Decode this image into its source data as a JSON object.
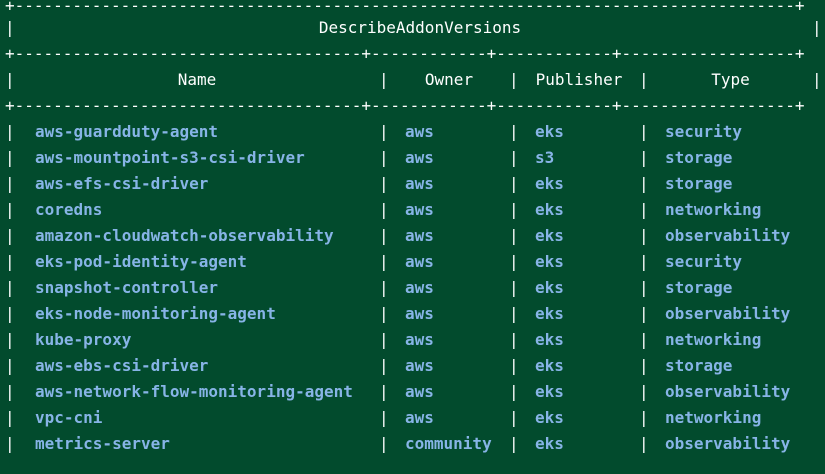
{
  "table": {
    "title": "DescribeAddonVersions",
    "headers": [
      "Name",
      "Owner",
      "Publisher",
      "Type"
    ],
    "rows": [
      [
        "aws-guardduty-agent",
        "aws",
        "eks",
        "security"
      ],
      [
        "aws-mountpoint-s3-csi-driver",
        "aws",
        "s3",
        "storage"
      ],
      [
        "aws-efs-csi-driver",
        "aws",
        "eks",
        "storage"
      ],
      [
        "coredns",
        "aws",
        "eks",
        "networking"
      ],
      [
        "amazon-cloudwatch-observability",
        "aws",
        "eks",
        "observability"
      ],
      [
        "eks-pod-identity-agent",
        "aws",
        "eks",
        "security"
      ],
      [
        "snapshot-controller",
        "aws",
        "eks",
        "storage"
      ],
      [
        "eks-node-monitoring-agent",
        "aws",
        "eks",
        "observability"
      ],
      [
        "kube-proxy",
        "aws",
        "eks",
        "networking"
      ],
      [
        "aws-ebs-csi-driver",
        "aws",
        "eks",
        "storage"
      ],
      [
        "aws-network-flow-monitoring-agent",
        "aws",
        "eks",
        "observability"
      ],
      [
        "vpc-cni",
        "aws",
        "eks",
        "networking"
      ],
      [
        "metrics-server",
        "community",
        "eks",
        "observability"
      ]
    ]
  },
  "colors": {
    "background": "#024b2d",
    "text": "#ffffff",
    "cell_text": "#87b4e6"
  }
}
